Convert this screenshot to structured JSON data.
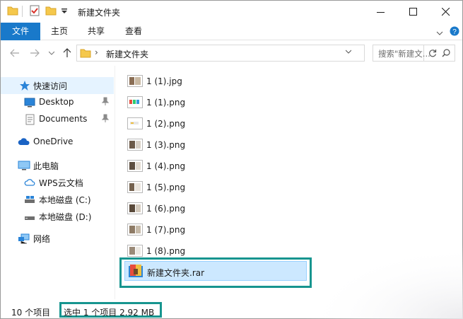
{
  "window": {
    "title": "新建文件夹"
  },
  "ribbon": {
    "tabs": [
      {
        "label": "文件"
      },
      {
        "label": "主页"
      },
      {
        "label": "共享"
      },
      {
        "label": "查看"
      }
    ]
  },
  "address": {
    "path": "新建文件夹",
    "search_placeholder": "搜索\"新建文..."
  },
  "nav": {
    "quick_access": "快速访问",
    "desktop": "Desktop",
    "documents": "Documents",
    "onedrive": "OneDrive",
    "this_pc": "此电脑",
    "wps": "WPS云文档",
    "drive_c": "本地磁盘 (C:)",
    "drive_d": "本地磁盘 (D:)",
    "network": "网络"
  },
  "files": [
    {
      "name": "1 (1).jpg",
      "icon": "image-photo-icon"
    },
    {
      "name": "1 (1).png",
      "icon": "image-colorful-icon"
    },
    {
      "name": "1 (2).png",
      "icon": "image-light-icon"
    },
    {
      "name": "1 (3).png",
      "icon": "image-photo-icon"
    },
    {
      "name": "1 (4).png",
      "icon": "image-photo-icon"
    },
    {
      "name": "1 (5).png",
      "icon": "image-photo-icon"
    },
    {
      "name": "1 (6).png",
      "icon": "image-photo-icon"
    },
    {
      "name": "1 (7).png",
      "icon": "image-photo-icon"
    },
    {
      "name": "1 (8).png",
      "icon": "image-photo-icon"
    },
    {
      "name": "新建文件夹.rar",
      "icon": "rar-archive-icon",
      "selected": true
    }
  ],
  "status": {
    "count": "10 个项目",
    "selection": "选中 1 个项目  2.92 MB"
  },
  "colors": {
    "accent": "#1979ca",
    "highlight": "#17958f",
    "selection": "#cce8ff"
  }
}
